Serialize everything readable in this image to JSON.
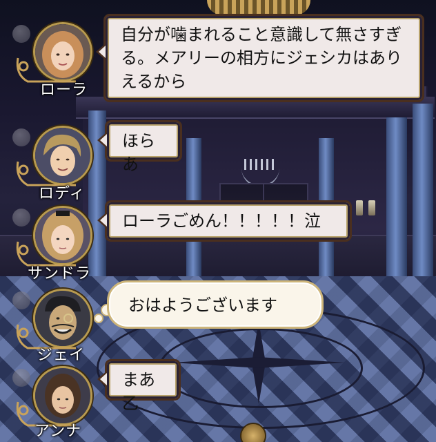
{
  "messages": [
    {
      "speaker": "ローラ",
      "text": "自分が噛まれること意識して無さすぎる。メアリーの相方にジェシカはありえるから",
      "style": "speech",
      "avatar": "laura-portrait"
    },
    {
      "speaker": "ロディ",
      "text": "ほらあ",
      "style": "speech",
      "avatar": "rody-portrait"
    },
    {
      "speaker": "サンドラ",
      "text": "ローラごめん！！！！！泣",
      "style": "speech",
      "avatar": "sandra-portrait"
    },
    {
      "speaker": "ジェイ",
      "text": "おはようございます",
      "style": "thought",
      "avatar": "jay-portrait"
    },
    {
      "speaker": "アンナ",
      "text": "まあ乙",
      "style": "speech",
      "avatar": "anna-portrait"
    }
  ],
  "colors": {
    "bubble_fill": "#f0e9e8",
    "bubble_border": "#4a2f1f",
    "gold": "#b89a4e",
    "nameplate_text": "#ffffff"
  }
}
